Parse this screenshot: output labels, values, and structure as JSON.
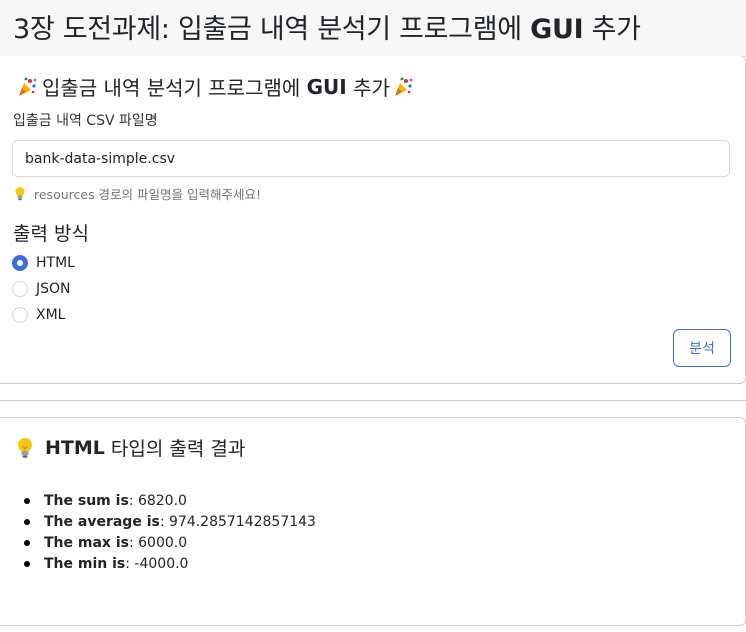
{
  "page": {
    "title_prefix": "3장 도전과제: 입출금 내역 분석기 프로그램에",
    "title_bold": "GUI",
    "title_suffix": "추가"
  },
  "form_card": {
    "title_prefix": "입출금 내역 분석기 프로그램에",
    "title_bold": "GUI",
    "title_suffix": "추가",
    "title_icon": "party-popper-icon",
    "file_label": "입출금 내역 CSV 파일명",
    "file_value": "bank-data-simple.csv",
    "hint_icon": "lightbulb-icon",
    "hint": "resources 경로의 파일명을 입력해주세요!",
    "output_label": "출력 방식",
    "options": [
      {
        "label": "HTML",
        "checked": true
      },
      {
        "label": "JSON",
        "checked": false
      },
      {
        "label": "XML",
        "checked": false
      }
    ],
    "analyze_button": "분석",
    "accent_color": "#3d6fd9"
  },
  "result_card": {
    "title_icon": "lightbulb-icon",
    "title_bold": "HTML",
    "title_rest": "타입의 출력 결과",
    "items": [
      {
        "label": "The sum is",
        "value": "6820.0"
      },
      {
        "label": "The average is",
        "value": "974.2857142857143"
      },
      {
        "label": "The max is",
        "value": "6000.0"
      },
      {
        "label": "The min is",
        "value": "-4000.0"
      }
    ]
  }
}
